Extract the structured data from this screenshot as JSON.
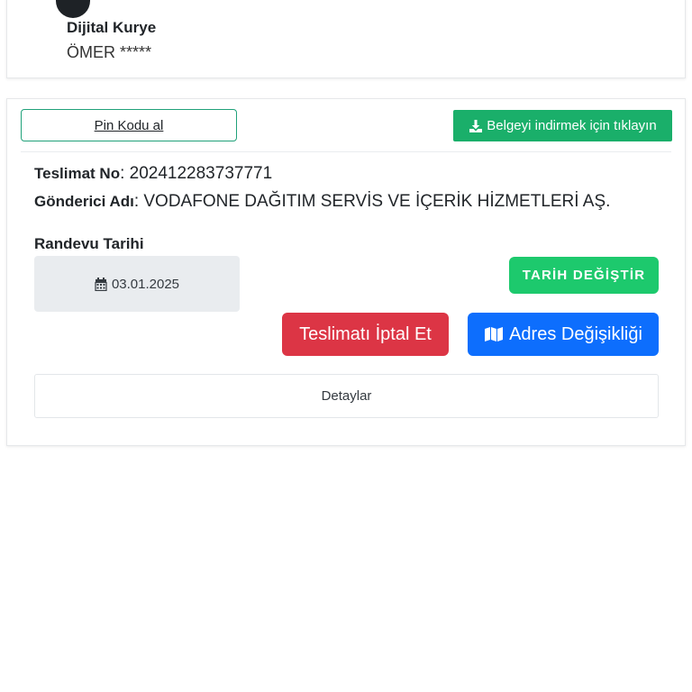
{
  "courier": {
    "role": "Dijital Kurye",
    "name": "ÖMER *****"
  },
  "actions": {
    "pin_label": "Pin Kodu al",
    "download_label": "Belgeyi indirmek için tıklayın",
    "download_icon": "download-icon"
  },
  "delivery": {
    "number_label": "Teslimat No",
    "number_value": ": 202412283737771",
    "sender_label": "Gönderici Adı",
    "sender_value": ": VODAFONE DAĞITIM SERVİS VE İÇERİK HİZMETLERİ AŞ."
  },
  "appointment": {
    "label": "Randevu Tarihi",
    "date": "03.01.2025",
    "calendar_icon": "calendar-icon",
    "change_date_label": "TARİH DEĞİŞTİR"
  },
  "buttons": {
    "cancel_label": "Teslimatı İptal Et",
    "address_label": "Adres Değişikliği",
    "address_icon": "map-icon"
  },
  "details_label": "Detaylar",
  "colors": {
    "green_outline": "#20a17a",
    "download_green": "#1aaf6a",
    "change_date_green": "#1dc96d",
    "cancel_red": "#dc3545",
    "address_blue": "#0d6efd"
  }
}
